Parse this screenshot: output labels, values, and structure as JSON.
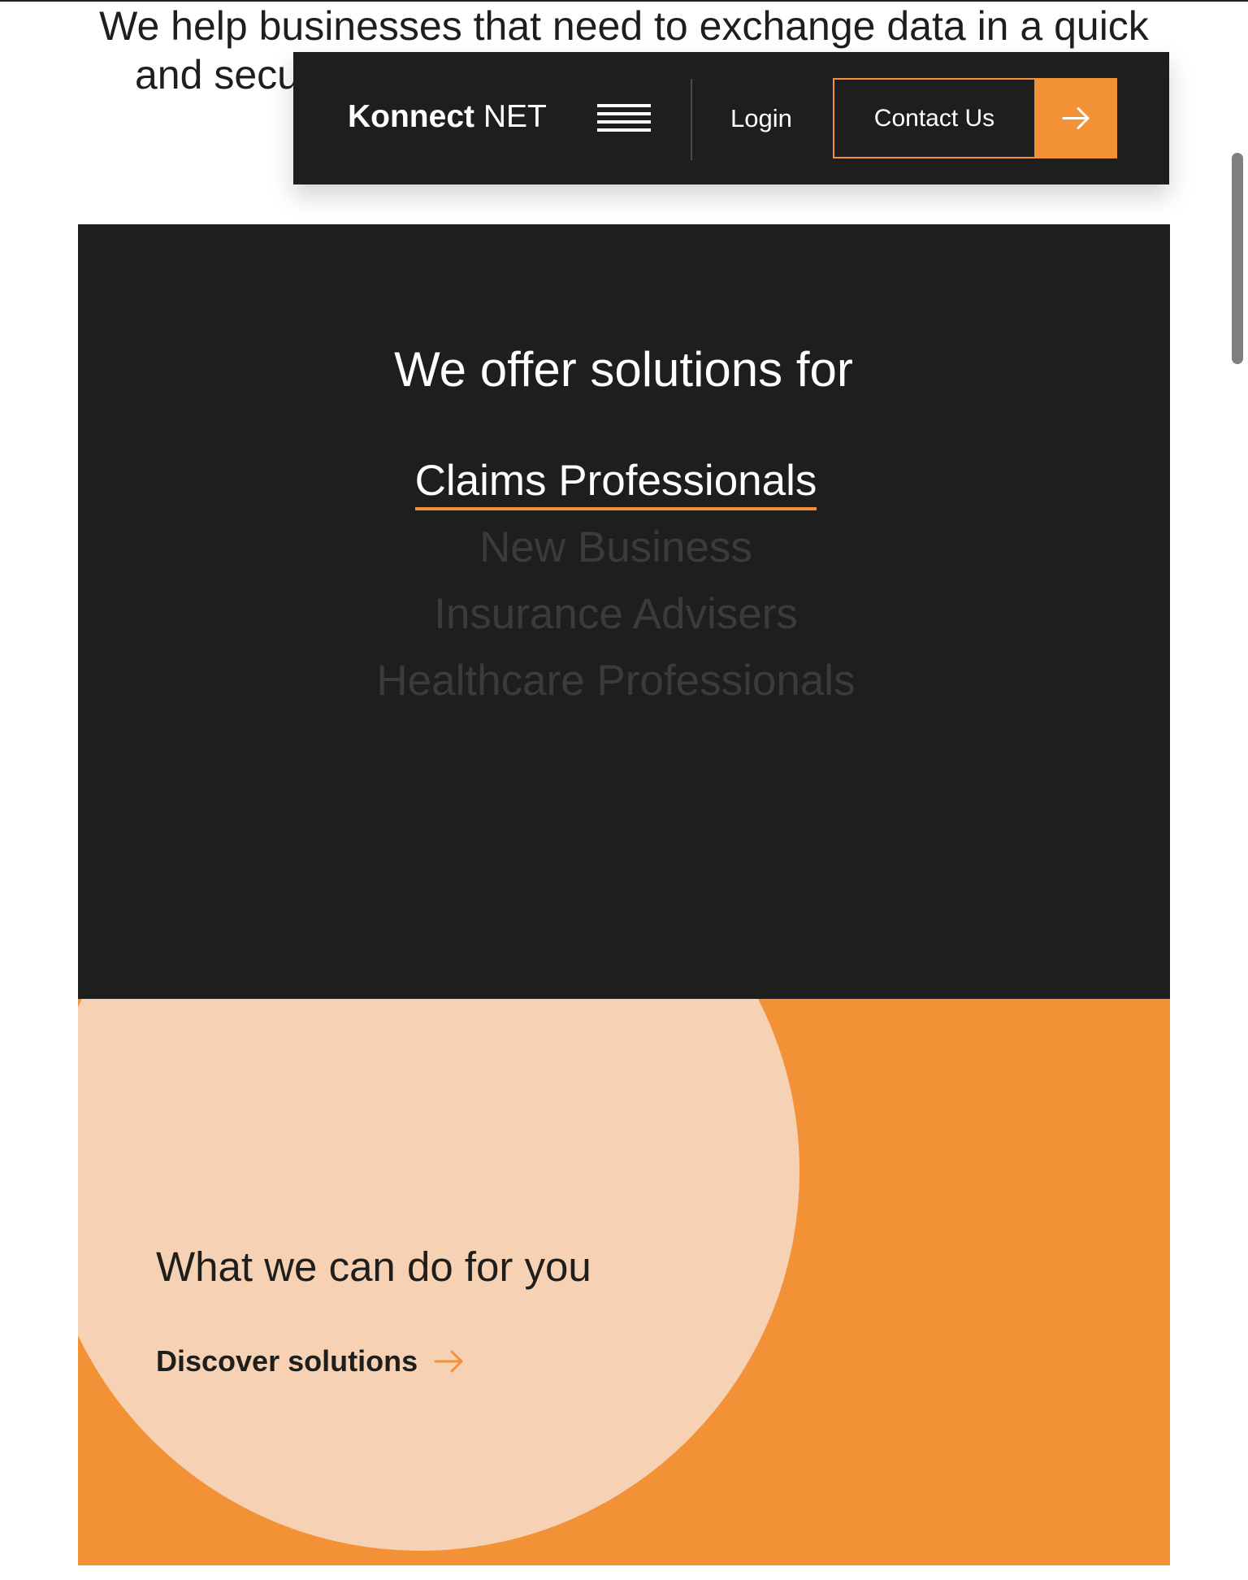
{
  "intro": {
    "line1": "We help businesses that need to exchange data in a quick",
    "line2": "and secu"
  },
  "header": {
    "logo_bold": "Konnect",
    "logo_regular": " NET",
    "menu_icon": "hamburger-menu-icon",
    "login_label": "Login",
    "contact_label": "Contact Us",
    "contact_icon": "arrow-right-icon"
  },
  "solutions": {
    "title": "We offer solutions for",
    "items": [
      {
        "label": "Claims Professionals",
        "active": true
      },
      {
        "label": "New Business",
        "active": false
      },
      {
        "label": "Insurance Advisers",
        "active": false
      },
      {
        "label": "Healthcare Professionals",
        "active": false
      }
    ]
  },
  "cta": {
    "title": "What we can do for you",
    "link_label": "Discover solutions",
    "link_icon": "arrow-right-icon"
  },
  "colors": {
    "dark": "#1e1f1d",
    "accent": "#f29136",
    "accent_light": "#f7d1b3",
    "inactive_text": "#3b3c3a"
  }
}
